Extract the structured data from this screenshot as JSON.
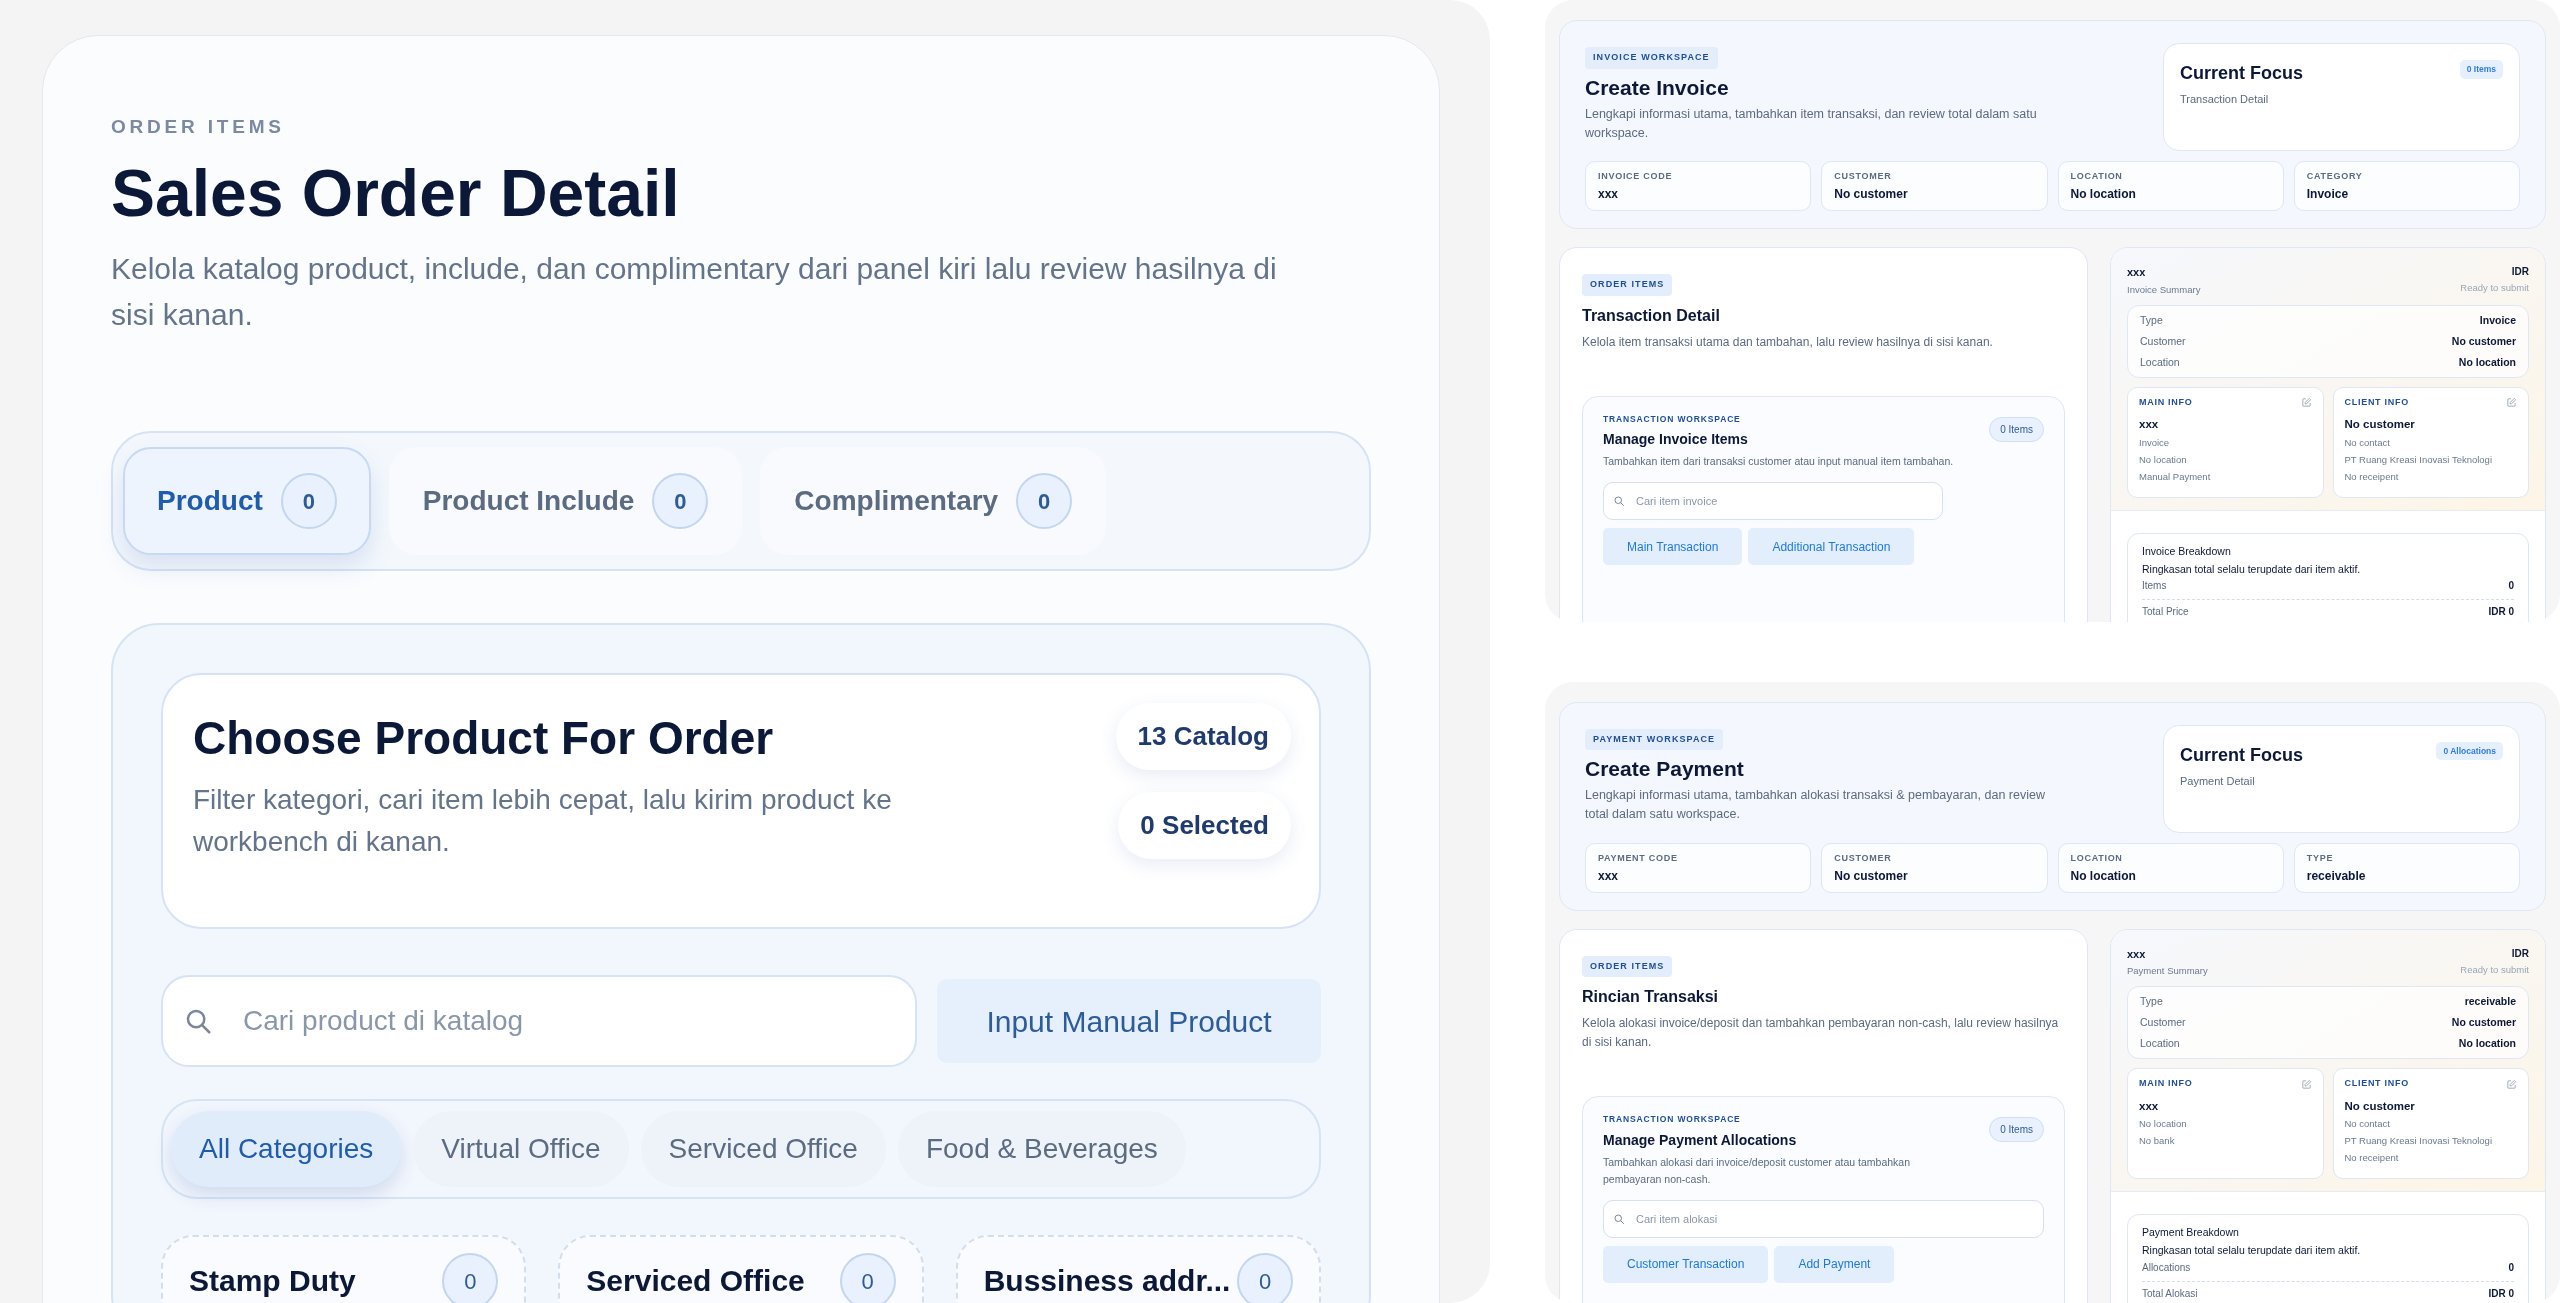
{
  "sales_order": {
    "eyebrow": "ORDER ITEMS",
    "title": "Sales Order Detail",
    "description": "Kelola katalog product, include, dan complimentary dari panel kiri lalu review hasilnya di sisi kanan.",
    "tabs": [
      {
        "label": "Product",
        "count": "0",
        "selected": true
      },
      {
        "label": "Product Include",
        "count": "0",
        "selected": false
      },
      {
        "label": "Complimentary",
        "count": "0",
        "selected": false
      }
    ],
    "chooser": {
      "title": "Choose Product For Order",
      "description": "Filter kategori, cari item lebih cepat, lalu kirim product ke workbench di kanan.",
      "badges": [
        "13 Catalog",
        "0 Selected"
      ]
    },
    "search": {
      "placeholder": "Cari product di katalog"
    },
    "manual_button": "Input Manual Product",
    "categories": [
      {
        "label": "All Categories",
        "selected": true
      },
      {
        "label": "Virtual Office",
        "selected": false
      },
      {
        "label": "Serviced Office",
        "selected": false
      },
      {
        "label": "Food & Beverages",
        "selected": false
      }
    ],
    "products": [
      {
        "name": "Stamp Duty",
        "count": "0"
      },
      {
        "name": "Serviced Office",
        "count": "0"
      },
      {
        "name": "Bussiness addr...",
        "count": "0"
      }
    ]
  },
  "workspaces": [
    {
      "badge": "INVOICE WORKSPACE",
      "title": "Create Invoice",
      "description": "Lengkapi informasi utama, tambahkan item transaksi, dan review total dalam satu workspace.",
      "focus": {
        "title": "Current Focus",
        "subtitle": "Transaction Detail",
        "badge": "0 Items"
      },
      "fields": [
        {
          "label": "INVOICE CODE",
          "value": "xxx"
        },
        {
          "label": "CUSTOMER",
          "value": "No customer"
        },
        {
          "label": "LOCATION",
          "value": "No location"
        },
        {
          "label": "CATEGORY",
          "value": "Invoice"
        }
      ],
      "order": {
        "badge": "ORDER ITEMS",
        "title": "Transaction Detail",
        "description": "Kelola item transaksi utama dan tambahan, lalu review hasilnya di sisi kanan.",
        "workspace": {
          "eyebrow": "TRANSACTION WORKSPACE",
          "title": "Manage Invoice Items",
          "count": "0 Items",
          "description": "Tambahkan item dari transaksi customer atau input manual item tambahan.",
          "search_placeholder": "Cari item invoice",
          "buttons": [
            "Main Transaction",
            "Additional Transaction"
          ]
        }
      },
      "summary": {
        "code": "xxx",
        "subtitle": "Invoice Summary",
        "currency": "IDR",
        "status": "Ready to submit",
        "rows": [
          {
            "label": "Type",
            "value": "Invoice"
          },
          {
            "label": "Customer",
            "value": "No customer"
          },
          {
            "label": "Location",
            "value": "No location"
          }
        ],
        "main_info": {
          "title": "MAIN INFO",
          "name": "xxx",
          "lines": [
            "Invoice",
            "No location",
            "Manual Payment"
          ]
        },
        "client_info": {
          "title": "CLIENT INFO",
          "name": "No customer",
          "lines": [
            "No contact",
            "PT Ruang Kreasi Inovasi Teknologi",
            "No receipent"
          ]
        },
        "breakdown": {
          "title": "Invoice Breakdown",
          "subtitle": "Ringkasan total selalu terupdate dari item aktif.",
          "rows": [
            {
              "label": "Items",
              "value": "0"
            },
            {
              "label": "Total Price",
              "value": "IDR 0"
            }
          ]
        }
      }
    },
    {
      "badge": "PAYMENT WORKSPACE",
      "title": "Create Payment",
      "description": "Lengkapi informasi utama, tambahkan alokasi transaksi & pembayaran, dan review total dalam satu workspace.",
      "focus": {
        "title": "Current Focus",
        "subtitle": "Payment Detail",
        "badge": "0 Allocations"
      },
      "fields": [
        {
          "label": "PAYMENT CODE",
          "value": "xxx"
        },
        {
          "label": "CUSTOMER",
          "value": "No customer"
        },
        {
          "label": "LOCATION",
          "value": "No location"
        },
        {
          "label": "TYPE",
          "value": "receivable"
        }
      ],
      "order": {
        "badge": "ORDER ITEMS",
        "title": "Rincian Transaksi",
        "description": "Kelola alokasi invoice/deposit dan tambahkan pembayaran non-cash, lalu review hasilnya di sisi kanan.",
        "workspace": {
          "eyebrow": "TRANSACTION WORKSPACE",
          "title": "Manage Payment Allocations",
          "count": "0 Items",
          "description": "Tambahkan alokasi dari invoice/deposit customer atau tambahkan pembayaran non-cash.",
          "search_placeholder": "Cari item alokasi",
          "buttons": [
            "Customer Transaction",
            "Add Payment"
          ]
        }
      },
      "summary": {
        "code": "xxx",
        "subtitle": "Payment Summary",
        "currency": "IDR",
        "status": "Ready to submit",
        "rows": [
          {
            "label": "Type",
            "value": "receivable"
          },
          {
            "label": "Customer",
            "value": "No customer"
          },
          {
            "label": "Location",
            "value": "No location"
          }
        ],
        "main_info": {
          "title": "MAIN INFO",
          "name": "xxx",
          "lines": [
            "No location",
            "No bank"
          ]
        },
        "client_info": {
          "title": "CLIENT INFO",
          "name": "No customer",
          "lines": [
            "No contact",
            "PT Ruang Kreasi Inovasi Teknologi",
            "No receipent"
          ]
        },
        "breakdown": {
          "title": "Payment Breakdown",
          "subtitle": "Ringkasan total selalu terupdate dari item aktif.",
          "rows": [
            {
              "label": "Allocations",
              "value": "0"
            },
            {
              "label": "Total Alokasi",
              "value": "IDR 0"
            }
          ]
        }
      }
    }
  ]
}
